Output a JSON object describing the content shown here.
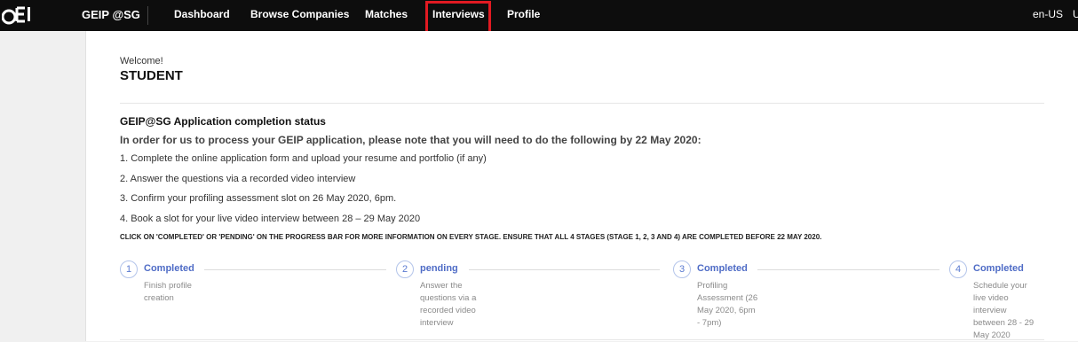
{
  "header": {
    "brand": "GEIP @SG",
    "nav": [
      "Dashboard",
      "Browse Companies",
      "Matches",
      "Interviews",
      "Profile"
    ],
    "highlighted_tab": "Interviews",
    "highlight_color": "#e11a22",
    "locale": "en-US",
    "user_initial": "U"
  },
  "welcome": {
    "greeting": "Welcome!",
    "name": "STUDENT"
  },
  "application": {
    "title": "GEIP@SG Application completion status",
    "instruction": "In order for us to process your GEIP application, please note that you will need to do the following by 22 May 2020:",
    "steps": [
      "1. Complete the online application form and upload your resume and portfolio (if any)",
      "2. Answer the questions via a recorded video interview",
      "3. Confirm your profiling assessment slot on 26 May 2020, 6pm.",
      "4. Book a slot for your live video interview between 28 – 29 May 2020"
    ],
    "note": "CLICK ON 'COMPLETED' OR 'PENDING' ON THE PROGRESS BAR FOR MORE INFORMATION ON EVERY STAGE. ENSURE THAT ALL 4 STAGES (STAGE 1, 2, 3 AND 4) ARE COMPLETED BEFORE 22 MAY 2020."
  },
  "progress": [
    {
      "number": "1",
      "status": "Completed",
      "description": "Finish profile creation"
    },
    {
      "number": "2",
      "status": "pending",
      "description": "Answer the questions via a recorded video interview"
    },
    {
      "number": "3",
      "status": "Completed",
      "description": "Profiling Assessment (26 May 2020, 6pm - 7pm)"
    },
    {
      "number": "4",
      "status": "Completed",
      "description": "Schedule your live video interview between 28 - 29 May 2020"
    }
  ]
}
